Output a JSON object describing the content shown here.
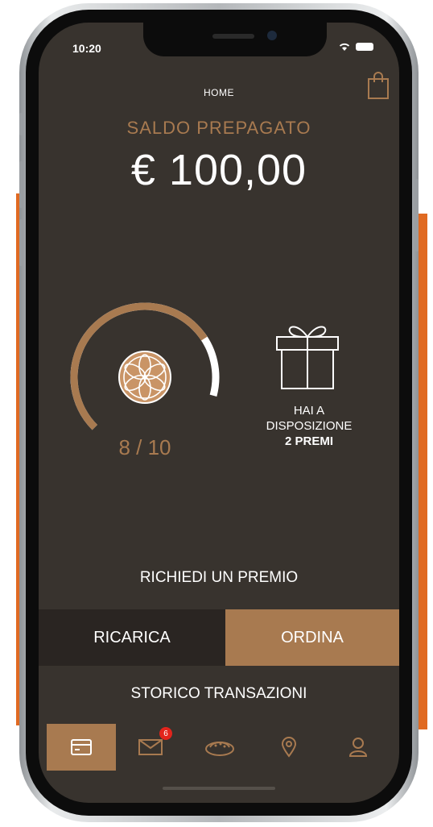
{
  "status_bar": {
    "time": "10:20",
    "icons": [
      "wifi-icon",
      "battery-icon"
    ]
  },
  "header": {
    "title": "HOME",
    "cart_icon": "shopping-bag-icon"
  },
  "balance": {
    "label": "SALDO PREPAGATO",
    "value": "€ 100,00"
  },
  "loyalty": {
    "progress_label": "8 / 10",
    "current": 8,
    "total": 10,
    "center_icon": "flower-medallion-icon"
  },
  "rewards": {
    "icon": "gift-icon",
    "line1": "HAI A",
    "line2": "DISPOSIZIONE",
    "line3": "2 PREMI"
  },
  "actions": {
    "request_reward": "RICHIEDI UN PREMIO",
    "recharge": "RICARICA",
    "order": "ORDINA",
    "history": "STORICO TRANSAZIONI"
  },
  "tabbar": {
    "items": [
      {
        "icon": "card-icon",
        "active": true
      },
      {
        "icon": "mail-icon",
        "badge": "6"
      },
      {
        "icon": "food-plate-icon"
      },
      {
        "icon": "location-pin-icon"
      },
      {
        "icon": "user-icon"
      }
    ]
  },
  "colors": {
    "background": "#38332e",
    "accent": "#a87a50",
    "dark_button": "#2a2522",
    "side_accent": "#e06a22",
    "badge": "#e2241c"
  }
}
